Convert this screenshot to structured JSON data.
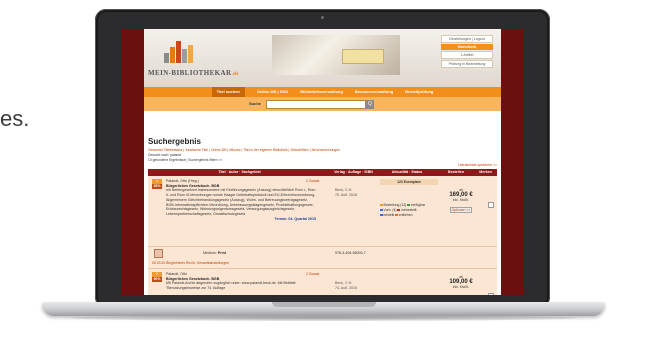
{
  "background_text": "es.",
  "page": {
    "logo": "MEIN-BIBLIOTHEKAR",
    "logo_suffix": ".de",
    "cart": {
      "line1": "Einstellungen | Logout",
      "btn": "Warenkorb",
      "line2": "1 Artikel",
      "line3": "Prüfung in Bearbeitung"
    },
    "nav": [
      {
        "label": "Titel suchen",
        "active": true
      },
      {
        "label": "Online-DB | SSO",
        "active": false
      },
      {
        "label": "Bibliotheksverwaltung",
        "active": false
      },
      {
        "label": "Benutzerverwaltung",
        "active": false
      },
      {
        "label": "Bestellprüfung",
        "active": false
      }
    ],
    "search": {
      "label": "Suche",
      "placeholder": "",
      "go": "Q"
    },
    "results": {
      "title": "Suchergebnis",
      "filters": "Gesamter Titelbestand | Juristische Titel | Online-DB | eBooks | Titel in der eigenen Bibliothek | Zeitschriften | Neuerscheinungen",
      "query": "Gesucht nach: palandt",
      "count": "10 gefundene Ergebnisse | Suchergebnis filtern >>",
      "list_link": "Literaturliste speichern >>"
    },
    "table_headers": [
      {
        "label": "Titel · Autor · Sachgebiet"
      },
      {
        "label": "Verlag · Auflage · ISBN"
      },
      {
        "label": "Aktualität · Status"
      },
      {
        "label": "Bestellen"
      },
      {
        "label": "Merken"
      }
    ],
    "items": [
      {
        "num": "1",
        "pct": "25%",
        "author": "Palandt, Otto (Hrsg.)",
        "title": "Bürgerliches Gesetzbuch. BGB",
        "description": "mit Nebengesetzen insbesondere mit Einführungsgesetz (Auszug) einschließlich Rom I-, Rom II- und Rom III-Verordnungen sowie Haager Unterhaltsprotokoll und EU-Erbrechtsverordnung, Allgemeinem Gleichbehandlungsgesetz (Auszug), Wohn- und Betreuungsvertragsgesetz, BGB-Informationspflichten-Verordnung, Unterlassungsklagengesetz, Produkthaftungsgesetz, Erbbaurechtsgesetz, Wohnungseigentumsgesetz, Versorgungsausgleichsgesetz, Lebenspartnerschaftsgesetz, Gewaltschutzgesetz",
        "dl": "2 Zusatz",
        "publisher": "Beck, C.H.",
        "edition": "75. Aufl. 2016",
        "termin": "Termin: 04. Quartal 2015",
        "stock": "123 Exemplare",
        "legend": [
          {
            "label": "Bestellung (13)",
            "color": "#f29a2e"
          },
          {
            "label": "verfügbar",
            "color": "#3a9a3a"
          },
          {
            "label": "Vorb. (4)",
            "color": "#3a6fc9"
          },
          {
            "label": "vorbestellt",
            "color": "#c03030"
          },
          {
            "label": "bestellt",
            "color": "#3a6fc9"
          },
          {
            "label": "entliehen",
            "color": "#d67520"
          }
        ],
        "price_label": "ab",
        "price": "169,00 €",
        "price_note": "inkl. MwSt.",
        "options": "Optionen >>",
        "medium_label": "Medium:",
        "medium": "Print",
        "isbn": "978-3-406-68000-7",
        "category": "05.03.30 Bürgerliches Recht, Gesamtdarstellungen"
      },
      {
        "num": "2",
        "pct": "90%",
        "author": "Palandt, Otto",
        "title": "Bürgerliches Gesetzbuch. BGB",
        "description": "Mit Palandt-Archiv abgerufen zugänglich unter: www.palandt.beck.de. Mit Beiblatt \"Benutzungshinweise zur 74. Auflage",
        "dl": "2 Zusatz",
        "publisher": "Beck, C.H.",
        "edition": "74. Aufl. 2015",
        "price_label": "ab",
        "price": "109,00 €",
        "price_note": "inkl. MwSt."
      }
    ]
  }
}
